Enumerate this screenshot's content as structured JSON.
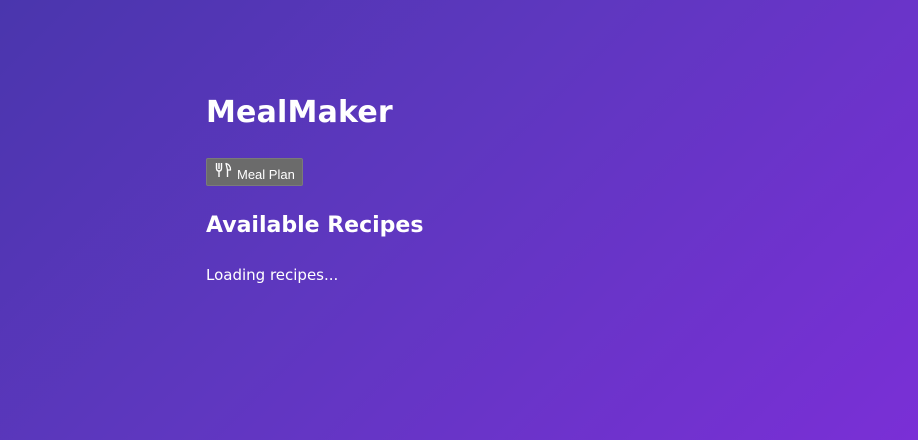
{
  "app": {
    "title": "MealMaker"
  },
  "toolbar": {
    "meal_plan_label": "Meal Plan",
    "meal_plan_icon": "fork-knife-icon"
  },
  "recipes": {
    "heading": "Available Recipes",
    "status": "Loading recipes..."
  },
  "colors": {
    "background_start": "#4a36ad",
    "background_end": "#7a2fd6",
    "button_background": "#6b6b6b",
    "text": "#ffffff"
  }
}
